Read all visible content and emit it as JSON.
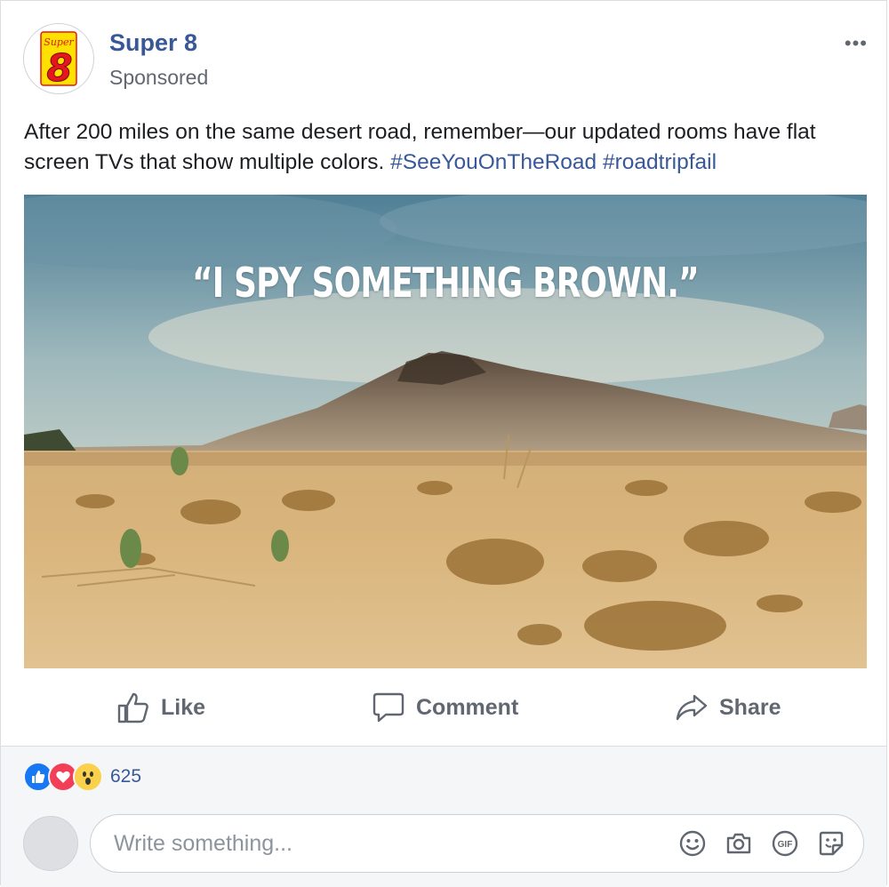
{
  "post": {
    "page_name": "Super 8",
    "sponsored_label": "Sponsored",
    "more_label": "•••",
    "logo": {
      "top_text": "Super",
      "big_text": "8",
      "icon": "super8-logo"
    },
    "body_text": "After 200 miles on the same desert road, remember—our updated rooms have flat screen TVs that show multiple colors. ",
    "hashtags": [
      "#SeeYouOnTheRoad",
      "#roadtripfail"
    ],
    "image": {
      "overlay_text": "“I SPY SOMETHING BROWN.”",
      "description_icon": "desert-photo"
    }
  },
  "actions": {
    "like_label": "Like",
    "comment_label": "Comment",
    "share_label": "Share"
  },
  "reactions": {
    "icons": [
      "like-reaction-icon",
      "love-reaction-icon",
      "wow-reaction-icon"
    ],
    "count": "625"
  },
  "comment": {
    "placeholder": "Write something..."
  },
  "colors": {
    "link": "#385898",
    "muted": "#606770",
    "like_blue": "#1877f2",
    "love_red": "#f33e58",
    "wow_yellow": "#fbd14b",
    "logo_yellow": "#ffe100",
    "logo_red": "#e3171d"
  }
}
